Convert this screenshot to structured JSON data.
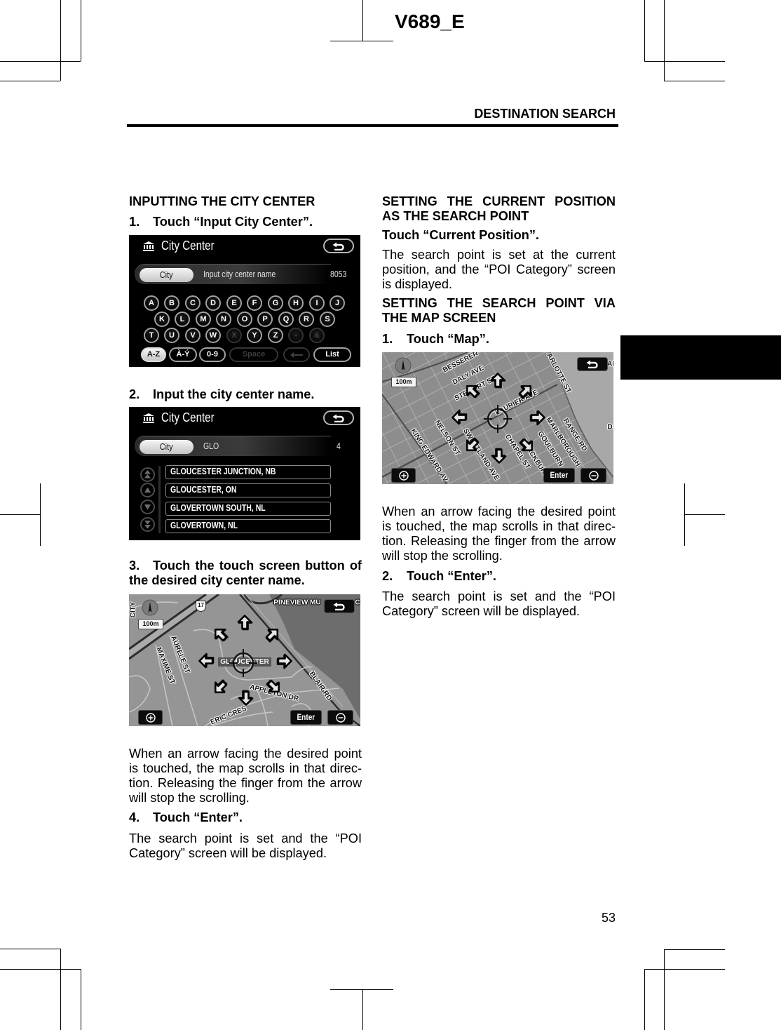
{
  "document": {
    "doc_code": "V689_E",
    "running_header": "DESTINATION SEARCH",
    "page_number": "53"
  },
  "left_column": {
    "heading": "INPUTTING THE CITY CENTER",
    "steps": [
      {
        "number": "1.",
        "text": "Touch “Input City Center”."
      },
      {
        "number": "2.",
        "text": "Input the city center name."
      },
      {
        "number": "3.",
        "text": "Touch the touch screen button of the desired city center name."
      },
      {
        "number": "4.",
        "text": "Touch “Enter”."
      }
    ],
    "scroll_note": "When an arrow facing the desired point is touched, the map scrolls in that direc­tion. Releasing the finger from the arrow will stop the scrolling.",
    "result_note": "The search point is set and the “POI Category” screen will be displayed."
  },
  "right_column": {
    "heading_current_position": "SETTING THE CURRENT POSITION AS THE SEARCH POINT",
    "current_position_instruction": "Touch “Current Position”.",
    "current_position_note": "The search point is set at the current position, and the “POI Category” screen is displayed.",
    "heading_map": "SETTING THE SEARCH POINT VIA THE MAP SCREEN",
    "steps": [
      {
        "number": "1.",
        "text": "Touch “Map”."
      },
      {
        "number": "2.",
        "text": "Touch “Enter”."
      }
    ],
    "scroll_note": "When an arrow facing the desired point is touched, the map scrolls in that direc­tion. Releasing the finger from the arrow will stop the scrolling.",
    "result_note": "The search point is set and the “POI Category” screen will be displayed."
  },
  "screens": {
    "city_keyboard": {
      "title": "City Center",
      "title_icon": "museum-icon",
      "back_icon": "return-arrow-icon",
      "field_button": "City",
      "input_placeholder": "Input city center name",
      "match_count": "8053",
      "key_rows": [
        [
          "A",
          "B",
          "C",
          "D",
          "E",
          "F",
          "G",
          "H",
          "I",
          "J"
        ],
        [
          "K",
          "L",
          "M",
          "N",
          "O",
          "P",
          "Q",
          "R",
          "S"
        ],
        [
          "T",
          "U",
          "V",
          "W",
          "X",
          "Y",
          "Z",
          "-",
          "&"
        ]
      ],
      "disabled_keys": [
        "X",
        "-",
        "&"
      ],
      "mode_buttons": [
        {
          "label": "A-Z",
          "selected": true
        },
        {
          "label": "À-Ý",
          "selected": false
        },
        {
          "label": "0-9",
          "selected": false
        }
      ],
      "space_label": "Space",
      "space_enabled": false,
      "backspace_icon": "left-arrow-icon",
      "backspace_enabled": false,
      "list_label": "List"
    },
    "city_list": {
      "title": "City Center",
      "field_button": "City",
      "input_value": "GLO",
      "match_count": "4",
      "scroll_icons": [
        "page-up-icon",
        "up-icon",
        "down-icon",
        "page-down-icon"
      ],
      "results": [
        "GLOUCESTER JUNCTION, NB",
        "GLOUCESTER, ON",
        "GLOVERTOWN SOUTH, NL",
        "GLOVERTOWN, NL"
      ]
    },
    "map_city_center": {
      "scale": "100m",
      "route_shield": "17",
      "center_label": "GLOUCESTER",
      "labels": [
        "CITY",
        "PINEVIEW MU",
        "C",
        "AURELE ST",
        "MAXIME ST",
        "BLAIR RD",
        "APPLETON DR",
        "ERIC CRES"
      ],
      "scroll_arrows": [
        "up",
        "up-left",
        "up-right",
        "left",
        "right",
        "down-left",
        "down-right",
        "down"
      ],
      "zoom_in_icon": "zoom-in-icon",
      "zoom_out_icon": "zoom-out-icon",
      "enter_label": "Enter"
    },
    "map_search_point": {
      "scale": "100m",
      "labels": [
        "BESSERER",
        "DALY AVE",
        "STEWART ST",
        "LAURIER AVE",
        "ARLOTTE ST",
        "KING EDWARD AV",
        "NELSON ST",
        "SWEETLAND AVE",
        "CHAPEL ST",
        "BLACKBURN",
        "GOULBURN",
        "MARLBOROUGH",
        "RANGE RD",
        "D",
        "AI"
      ],
      "scroll_arrows": [
        "up",
        "up-left",
        "up-right",
        "left",
        "right",
        "down-left",
        "down-right",
        "down"
      ],
      "zoom_in_icon": "zoom-in-icon",
      "zoom_out_icon": "zoom-out-icon",
      "enter_label": "Enter"
    }
  },
  "colors": {
    "text": "#000000",
    "rule": "#000000",
    "chapter_tab": "#000000",
    "screen_background": "#000000",
    "selected_button": "#d8d8d8",
    "map_background": "#959595"
  }
}
